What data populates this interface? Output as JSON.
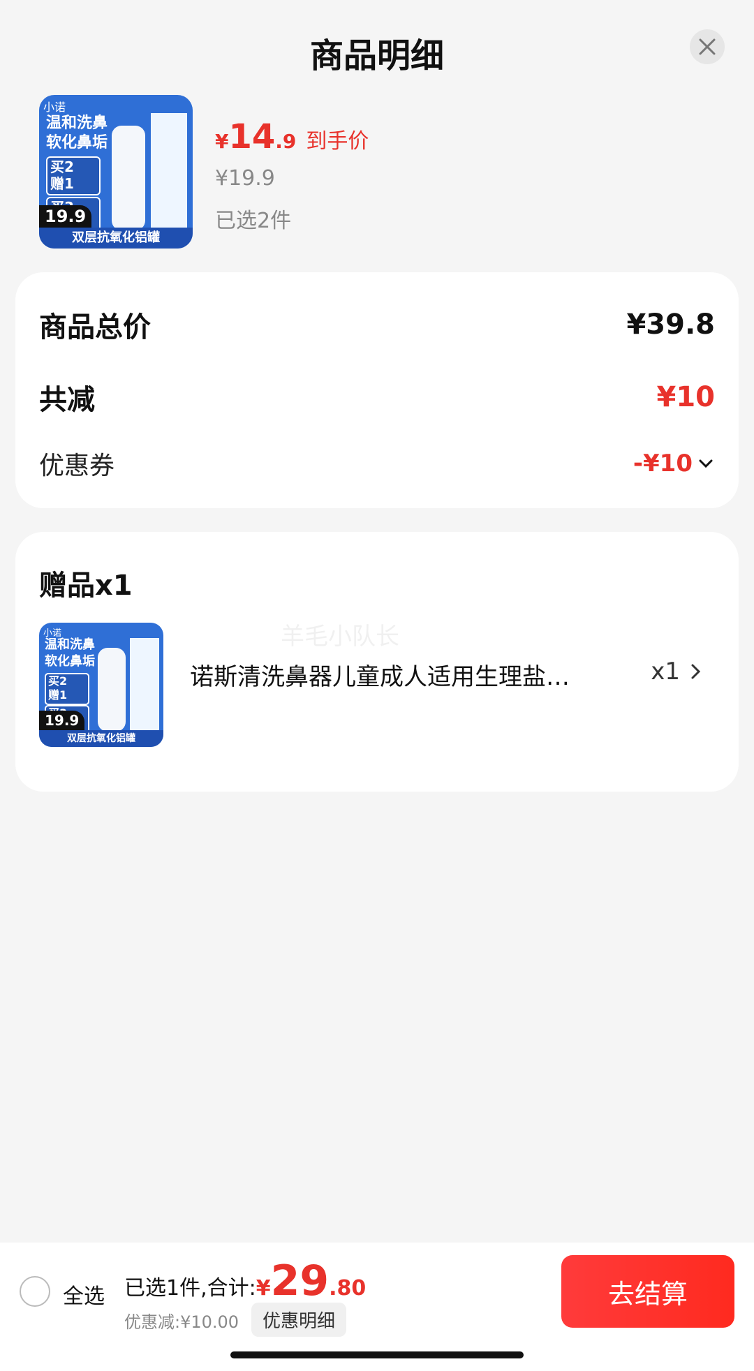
{
  "header": {
    "title": "商品明细"
  },
  "product": {
    "pay_price_yen": "¥",
    "pay_price_int": "14",
    "pay_price_dec": ".9",
    "pay_label": "到手价",
    "original_price": "¥19.9",
    "selected_count": "已选2件",
    "thumbnail": {
      "brand": "小诺",
      "promo_line1": "温和洗鼻",
      "promo_line2": "软化鼻垢",
      "buy2": "买2",
      "get1": "赠1",
      "buy3": "买3",
      "get2": "赠2",
      "price_badge": "19.9",
      "bottom_strip": "双层抗氧化铝罐"
    }
  },
  "price_summary": {
    "total_label": "商品总价",
    "total_value": "¥39.8",
    "reduce_label": "共减",
    "reduce_value": "¥10",
    "coupon_label": "优惠券",
    "coupon_value": "-¥10"
  },
  "gift": {
    "title": "赠品x1",
    "watermark": "羊毛小队长",
    "name": "诺斯清洗鼻器儿童成人适用生理盐水洗鼻器",
    "qty": "x1"
  },
  "bottom_bar": {
    "select_all": "全选",
    "total_prefix": "已选1件,合计:",
    "total_yen": "¥",
    "total_int": "29",
    "total_dec": ".80",
    "discount_text": "优惠减:¥10.00",
    "detail_button": "优惠明细",
    "checkout_button": "去结算"
  },
  "colors": {
    "accent_red": "#e8322b",
    "checkout_gradient": "#ff3b3b"
  }
}
